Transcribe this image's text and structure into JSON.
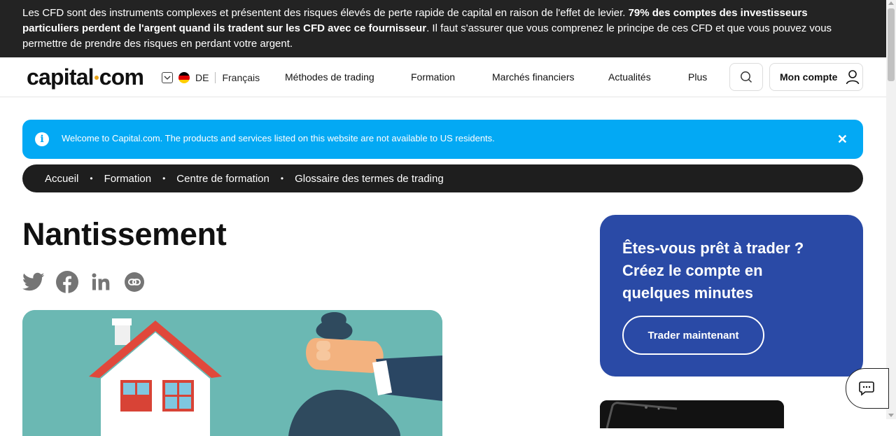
{
  "risk_warning": {
    "text_before": "Les CFD sont des instruments complexes et présentent des risques élevés de perte rapide de capital en raison de l'effet de levier. ",
    "text_bold": "79% des comptes des investisseurs particuliers perdent de l'argent quand ils tradent sur les CFD avec ce fournisseur",
    "text_after": ". Il faut s'assurer que vous comprenez le principe de ces CFD et que vous pouvez vous permettre de prendre des risques en perdant votre argent."
  },
  "header": {
    "logo_left": "capital",
    "logo_right": "com",
    "region": "DE",
    "language": "Français",
    "nav": [
      "Méthodes de trading",
      "Formation",
      "Marchés financiers",
      "Actualités",
      "Plus"
    ],
    "account_label": "Mon compte",
    "icons": {
      "search": "search-icon",
      "account": "user-icon",
      "region": "chevron-down-icon",
      "flag": "germany-flag-icon"
    }
  },
  "notice": {
    "message": "Welcome to Capital.com. The products and services listed on this website are not available to US residents.",
    "close": "✕"
  },
  "breadcrumb": [
    "Accueil",
    "Formation",
    "Centre de formation",
    "Glossaire des termes de trading"
  ],
  "page": {
    "title": "Nantissement",
    "share_icons": [
      "twitter-icon",
      "facebook-icon",
      "linkedin-icon",
      "copy-link-icon"
    ]
  },
  "cta": {
    "title": "Êtes-vous prêt à trader ? Créez le compte en quelques minutes",
    "button": "Trader maintenant"
  },
  "colors": {
    "risk_bar": "#232323",
    "notice": "#03a9f4",
    "breadcrumb": "#1e1e1e",
    "cta_card": "#2a4aa6",
    "logo_dot": "#e8a317"
  }
}
